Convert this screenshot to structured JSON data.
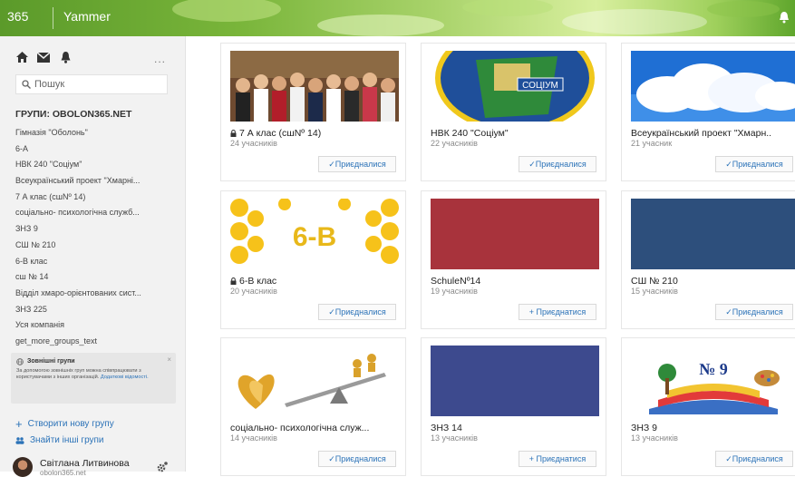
{
  "topbar": {
    "brand": "365",
    "app": "Yammer",
    "icons": [
      "bell-icon"
    ]
  },
  "sidebar": {
    "nav_icons": [
      "home-icon",
      "inbox-icon",
      "notifications-icon"
    ],
    "more_label": "...",
    "search_placeholder": "Пошук",
    "groups_title": "ГРУПИ: OBOLON365.NET",
    "groups": [
      "Гімназія \"Оболонь\"",
      "6-А",
      "НВК 240 \"Соціум\"",
      "Всеукраїнський проект \"Хмарні...",
      "7 А клас (сшNº 14)",
      "соціально- психологічна служб...",
      "ЗНЗ 9",
      "СШ № 210",
      "6-В клас",
      "сш № 14",
      "Відділ хмаро-орієнтованих сист...",
      "ЗНЗ 225",
      "Уся компанія",
      "get_more_groups_text"
    ],
    "external": {
      "title": "Зовнішні групи",
      "body": "За допомогою зовнішніх груп можна співпрацювати з користувачами з інших організацій.",
      "link": "Додаткові відомості."
    },
    "create_label": "Створити нову групу",
    "find_label": "Знайти інші групи",
    "user_name": "Світлана Литвинова",
    "user_sub": "obolon365.net"
  },
  "cards": [
    {
      "name": "7 А клас (сшNº 14)",
      "count": "24 учасників",
      "button": "✓Приєдналися",
      "locked": true
    },
    {
      "name": "НВК 240 \"Соціум\"",
      "count": "22 учасників",
      "button": "✓Приєдналися",
      "locked": false
    },
    {
      "name": "Всеукраїнський проект \"Хмарн..",
      "count": "21 учасник",
      "button": "✓Приєдналися",
      "locked": false
    },
    {
      "name": "6-В клас",
      "count": "20 учасників",
      "button": "✓Приєдналися",
      "locked": true
    },
    {
      "name": "SchuleNº14",
      "count": "19 учасників",
      "button": "+ Приєднатися",
      "locked": false
    },
    {
      "name": "СШ № 210",
      "count": "15 учасників",
      "button": "✓Приєдналися",
      "locked": false
    },
    {
      "name": "соціально- психологічна служ...",
      "count": "14 учасників",
      "button": "✓Приєдналися",
      "locked": false
    },
    {
      "name": "ЗНЗ 14",
      "count": "13 учасників",
      "button": "+ Приєднатися",
      "locked": false
    },
    {
      "name": "ЗНЗ 9",
      "count": "13 учасників",
      "button": "✓Приєдналися",
      "locked": false
    }
  ],
  "card_images": {
    "badge_6b": "6-В",
    "badge_socium": "СОЦІУМ",
    "badge_no9": "№ 9"
  },
  "colors": {
    "link": "#2c73b8",
    "red_cover": "#a8333c",
    "blue_cover": "#2d4f7c",
    "indigo_cover": "#3d4a8e"
  }
}
